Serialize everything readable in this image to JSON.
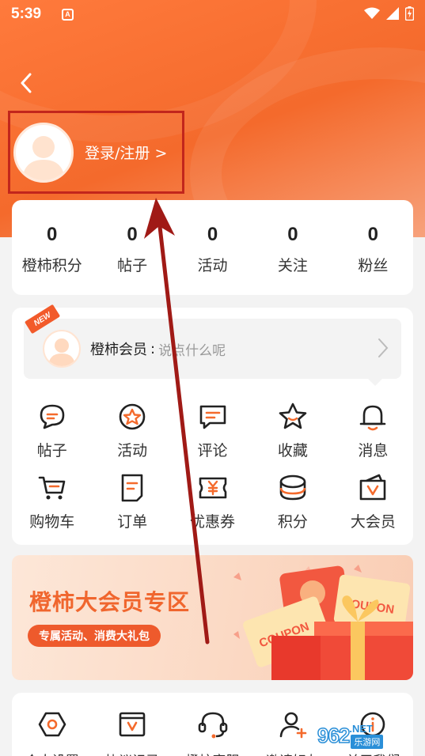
{
  "status_bar": {
    "time": "5:39",
    "notification_icon": "A"
  },
  "header": {
    "back_icon": "chevron-left-icon",
    "login_label": "登录/注册 >"
  },
  "stats": [
    {
      "value": "0",
      "label": "橙柿积分"
    },
    {
      "value": "0",
      "label": "帖子"
    },
    {
      "value": "0",
      "label": "活动"
    },
    {
      "value": "0",
      "label": "关注"
    },
    {
      "value": "0",
      "label": "粉丝"
    }
  ],
  "member": {
    "badge": "NEW",
    "name": "橙柿会员",
    "separator": ":",
    "placeholder": "说点什么呢"
  },
  "grid": [
    {
      "label": "帖子",
      "icon": "chat-bubble-icon"
    },
    {
      "label": "活动",
      "icon": "star-badge-icon"
    },
    {
      "label": "评论",
      "icon": "comment-icon"
    },
    {
      "label": "收藏",
      "icon": "star-icon"
    },
    {
      "label": "消息",
      "icon": "bell-icon"
    },
    {
      "label": "购物车",
      "icon": "cart-icon"
    },
    {
      "label": "订单",
      "icon": "order-icon"
    },
    {
      "label": "优惠券",
      "icon": "coupon-icon"
    },
    {
      "label": "积分",
      "icon": "coins-icon"
    },
    {
      "label": "大会员",
      "icon": "vip-icon"
    }
  ],
  "promo": {
    "title": "橙柿大会员专区",
    "subtitle": "专属活动、消费大礼包",
    "coupon_text": "COUPON"
  },
  "tools": [
    {
      "label": "个人设置",
      "icon": "settings-icon"
    },
    {
      "label": "协议记录",
      "icon": "vip-record-icon"
    },
    {
      "label": "橙柿客服",
      "icon": "headset-icon"
    },
    {
      "label": "邀请好友",
      "icon": "add-user-icon"
    },
    {
      "label": "关于我们",
      "icon": "info-icon"
    }
  ],
  "watermark": {
    "brand": "962",
    "suffix": ".NET",
    "subtitle": "乐游网"
  },
  "colors": {
    "accent": "#f46a2c",
    "highlight_box": "#c2261c",
    "arrow": "#a01a16"
  }
}
